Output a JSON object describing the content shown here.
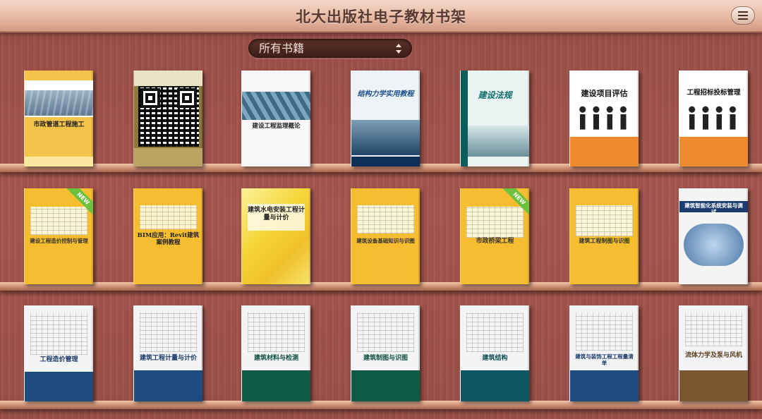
{
  "header": {
    "title": "北大出版社电子教材书架"
  },
  "filter": {
    "selected": "所有书籍"
  },
  "badges": {
    "new": "NEW"
  },
  "shelves": [
    {
      "books": [
        {
          "title": "市政管道工程施工",
          "style": "yellow-photo"
        },
        {
          "title": "",
          "style": "qr"
        },
        {
          "title": "建设工程监理概论",
          "style": "white-photo"
        },
        {
          "title": "结构力学实用教程",
          "style": "blue-photo"
        },
        {
          "title": "建设法规",
          "style": "teal-photo"
        },
        {
          "title": "建设项目评估",
          "style": "orange-people"
        },
        {
          "title": "工程招标投标管理",
          "style": "orange-people"
        }
      ]
    },
    {
      "books": [
        {
          "title": "建设工程造价控制与管理",
          "style": "yellow-sketch",
          "new": true
        },
        {
          "title": "BIM应用：Revit建筑案例教程",
          "style": "yellow-sketch2"
        },
        {
          "title": "建筑水电安装工程计量与计价",
          "style": "yellow-tiles"
        },
        {
          "title": "建筑设备基础知识与识图",
          "style": "yellow-sketch3"
        },
        {
          "title": "市政桥梁工程",
          "style": "yellow-bridge",
          "new": true
        },
        {
          "title": "建筑工程制图与识图",
          "style": "yellow-sketch"
        },
        {
          "title": "建筑智能化系统安装与调试",
          "style": "white-tech"
        }
      ]
    },
    {
      "books": [
        {
          "title": "工程造价管理",
          "style": "navy-sketch"
        },
        {
          "title": "建筑工程计量与计价",
          "style": "navy-sketch"
        },
        {
          "title": "建筑材料与检测",
          "style": "green-sketch"
        },
        {
          "title": "建筑制图与识图",
          "style": "green-sketch"
        },
        {
          "title": "建筑结构",
          "style": "teal-sketch"
        },
        {
          "title": "建筑与装饰工程工程量清单",
          "style": "navy-sketch"
        },
        {
          "title": "流体力学及泵与风机",
          "style": "brown-sketch"
        }
      ]
    }
  ]
}
